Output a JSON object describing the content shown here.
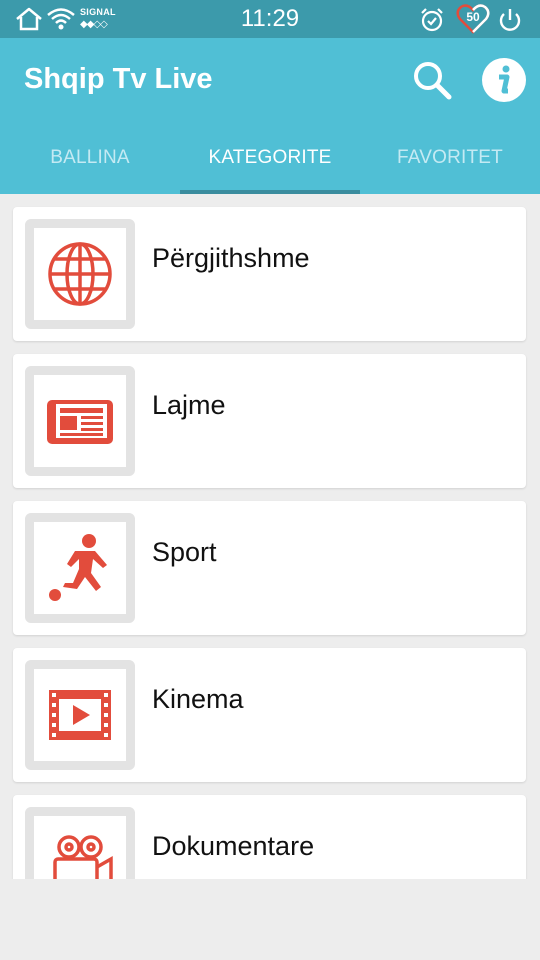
{
  "status_bar": {
    "time": "11:29",
    "signal_label": "SIGNAL",
    "signal_dots": "◆◆◇◇",
    "battery_level": "50",
    "icons": [
      "home-icon",
      "wifi-icon",
      "alarm-icon",
      "battery-heart-icon",
      "power-icon"
    ]
  },
  "app_bar": {
    "title": "Shqip Tv Live",
    "actions": [
      "search-icon",
      "info-icon"
    ],
    "colors": {
      "primary": "#50bfd5",
      "status": "#3c9aab",
      "indicator": "#3a8c9e",
      "accent_icon": "#e24c3c"
    }
  },
  "tabs": [
    {
      "label": "BALLINA",
      "active": false
    },
    {
      "label": "KATEGORITE",
      "active": true
    },
    {
      "label": "FAVORITET",
      "active": false
    }
  ],
  "categories": [
    {
      "label": "Përgjithshme",
      "icon": "globe-icon"
    },
    {
      "label": "Lajme",
      "icon": "newspaper-icon"
    },
    {
      "label": "Sport",
      "icon": "soccer-player-icon"
    },
    {
      "label": "Kinema",
      "icon": "film-icon"
    },
    {
      "label": "Dokumentare",
      "icon": "video-camera-icon"
    }
  ]
}
